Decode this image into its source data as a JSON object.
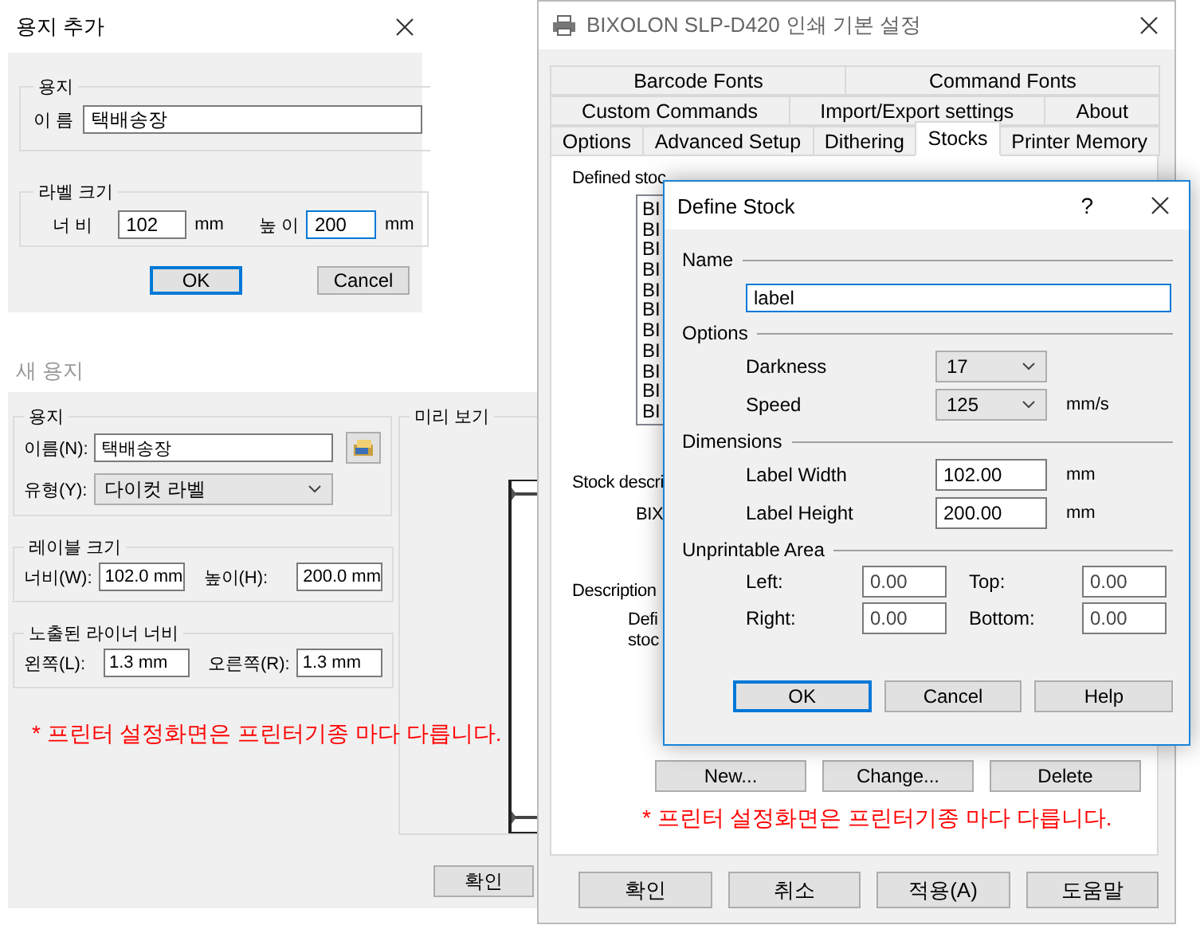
{
  "add_paper": {
    "title": "용지 추가",
    "paper_group": {
      "legend": "용지",
      "name_label": "이 름",
      "name_value": "택배송장"
    },
    "size_group": {
      "legend": "라벨 크기",
      "width_label": "너 비",
      "width_value": "102",
      "width_unit": "mm",
      "height_label": "높 이",
      "height_value": "200",
      "height_unit": "mm",
      "height_focused": true
    },
    "buttons": [
      {
        "label": "OK",
        "default": true
      },
      {
        "label": "Cancel",
        "default": false
      }
    ]
  },
  "new_paper": {
    "title": "새 용지",
    "paper_group": {
      "legend": "용지",
      "name_label": "이름(N):",
      "name_value": "택배송장",
      "type_label": "유형(Y):",
      "type_value": "다이컷 라벨"
    },
    "size_group": {
      "legend": "레이블 크기",
      "width_label": "너비(W):",
      "width_value": "102.0 mm",
      "height_label": "높이(H):",
      "height_value": "200.0 mm"
    },
    "liner_group": {
      "legend": "노출된 라이너 너비",
      "left_label": "왼쪽(L):",
      "left_value": "1.3 mm",
      "right_label": "오른쪽(R):",
      "right_value": "1.3 mm"
    },
    "note": "* 프린터 설정화면은 프린터기종 마다 다릅니다.",
    "preview": {
      "legend": "미리 보기"
    },
    "buttons": [
      {
        "label": "확인",
        "default": false
      }
    ]
  },
  "printer_window": {
    "title": "BIXOLON SLP-D420 인쇄 기본 설정",
    "tab_rows": [
      [
        {
          "label": "Barcode Fonts",
          "selected": false
        },
        {
          "label": "Command Fonts",
          "selected": false
        }
      ],
      [
        {
          "label": "Custom Commands",
          "selected": false
        },
        {
          "label": "Import/Export settings",
          "selected": false
        },
        {
          "label": "About",
          "selected": false
        }
      ],
      [
        {
          "label": "Options",
          "selected": false
        },
        {
          "label": "Advanced Setup",
          "selected": false
        },
        {
          "label": "Dithering",
          "selected": false
        },
        {
          "label": "Stocks",
          "selected": true
        },
        {
          "label": "Printer Memory",
          "selected": false
        }
      ]
    ],
    "stocks_panel": {
      "defined_label": "Defined stoc",
      "stock_items": [
        "BI",
        "BI",
        "BI",
        "BI",
        "BI",
        "BI",
        "BI",
        "BI",
        "BI",
        "BI",
        "BI"
      ],
      "stock_description_label": "Stock descri",
      "stock_description_value": "BIX",
      "description_label": "Description",
      "description_lines": [
        "Defi",
        "stoc"
      ],
      "buttons": [
        {
          "label": "New...",
          "default": false
        },
        {
          "label": "Change...",
          "default": false
        },
        {
          "label": "Delete",
          "default": false
        }
      ],
      "note": "* 프린터 설정화면은 프린터기종 마다 다릅니다."
    },
    "buttons": [
      {
        "label": "확인",
        "default": false
      },
      {
        "label": "취소",
        "default": false
      },
      {
        "label": "적용(A)",
        "default": false
      },
      {
        "label": "도움말",
        "default": false
      }
    ]
  },
  "define_stock": {
    "title": "Define Stock",
    "help": "?",
    "name_section": {
      "legend": "Name",
      "value": "label"
    },
    "options_section": {
      "legend": "Options",
      "darkness_label": "Darkness",
      "darkness_value": "17",
      "speed_label": "Speed",
      "speed_value": "125",
      "speed_unit": "mm/s"
    },
    "dimensions_section": {
      "legend": "Dimensions",
      "width_label": "Label Width",
      "width_value": "102.00",
      "width_unit": "mm",
      "height_label": "Label Height",
      "height_value": "200.00",
      "height_unit": "mm"
    },
    "unprintable_section": {
      "legend": "Unprintable Area",
      "left_label": "Left:",
      "left_value": "0.00",
      "top_label": "Top:",
      "top_value": "0.00",
      "right_label": "Right:",
      "right_value": "0.00",
      "bottom_label": "Bottom:",
      "bottom_value": "0.00"
    },
    "buttons": [
      {
        "label": "OK",
        "default": true
      },
      {
        "label": "Cancel",
        "default": false
      },
      {
        "label": "Help",
        "default": false
      }
    ]
  }
}
